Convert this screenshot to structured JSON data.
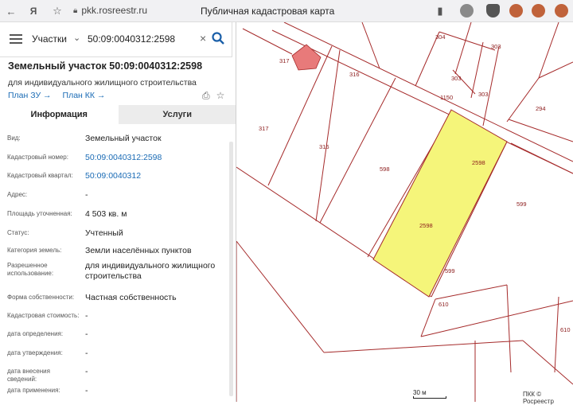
{
  "browser": {
    "url": "pkk.rosreestr.ru",
    "page_title": "Публичная кадастровая карта"
  },
  "search": {
    "type_label": "Участки",
    "query": "50:09:0040312:2598"
  },
  "parcel": {
    "title": "Земельный участок 50:09:0040312:2598",
    "subtitle": "для индивидуального жилищного строительства",
    "links": [
      "План ЗУ →",
      "План КК →"
    ]
  },
  "tabs": [
    {
      "label": "Информация"
    },
    {
      "label": "Услуги"
    }
  ],
  "info": [
    {
      "label": "Вид:",
      "value": "Земельный участок"
    },
    {
      "label": "Кадастровый номер:",
      "value": "50:09:0040312:2598"
    },
    {
      "label": "Кадастровый квартал:",
      "value": "50:09:0040312"
    },
    {
      "label": "Адрес:",
      "value": "-"
    },
    {
      "label": "Площадь уточненная:",
      "value": "4 503 кв. м"
    },
    {
      "label": "Статус:",
      "value": "Учтенный"
    },
    {
      "label": "Категория земель:",
      "value": "Земли населённых пунктов"
    },
    {
      "label": "Разрешенное использование:",
      "value": "для индивидуального жилищного строительства"
    },
    {
      "label": "Форма собственности:",
      "value": "Частная собственность"
    },
    {
      "label": "Кадастровая стоимость:",
      "value": "-"
    },
    {
      "label": "дата определения:",
      "value": "-"
    },
    {
      "label": "дата утверждения:",
      "value": "-"
    },
    {
      "label": "дата внесения сведений:",
      "value": "-"
    },
    {
      "label": "дата применения:",
      "value": "-"
    }
  ],
  "map": {
    "labels": [
      "304",
      "303",
      "317",
      "316",
      "303",
      "1150",
      "303",
      "294",
      "317",
      "316",
      "598",
      "2598",
      "2598",
      "599",
      "599",
      "610",
      "610"
    ],
    "scale": "30 м",
    "copyright": "ПКК © Росреестр",
    "highlight_color": "#f5f57a",
    "boundary_color": "#a52a2a"
  }
}
